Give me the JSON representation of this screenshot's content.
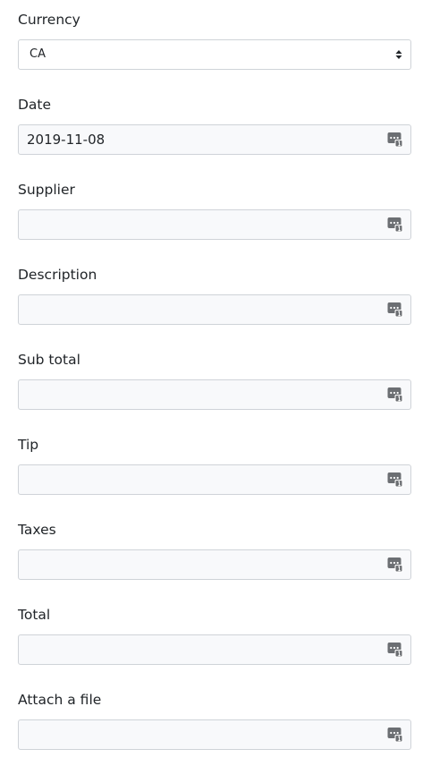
{
  "currency": {
    "label": "Currency",
    "selected": "CA"
  },
  "fields": [
    {
      "label": "Date",
      "value": "2019-11-08",
      "icon": "password-manager-icon"
    },
    {
      "label": "Supplier",
      "value": "",
      "icon": "password-manager-icon"
    },
    {
      "label": "Description",
      "value": "",
      "icon": "password-manager-icon"
    },
    {
      "label": "Sub total",
      "value": "",
      "icon": "password-manager-icon"
    },
    {
      "label": "Tip",
      "value": "",
      "icon": "password-manager-icon"
    },
    {
      "label": "Taxes",
      "value": "",
      "icon": "password-manager-icon"
    },
    {
      "label": "Total",
      "value": "",
      "icon": "password-manager-icon"
    },
    {
      "label": "Attach a file",
      "value": "",
      "icon": "password-manager-icon"
    }
  ],
  "colors": {
    "border": "#cfd3d8",
    "input_background": "#f8f9fb",
    "text": "#212529",
    "icon": "#6c6f73"
  }
}
